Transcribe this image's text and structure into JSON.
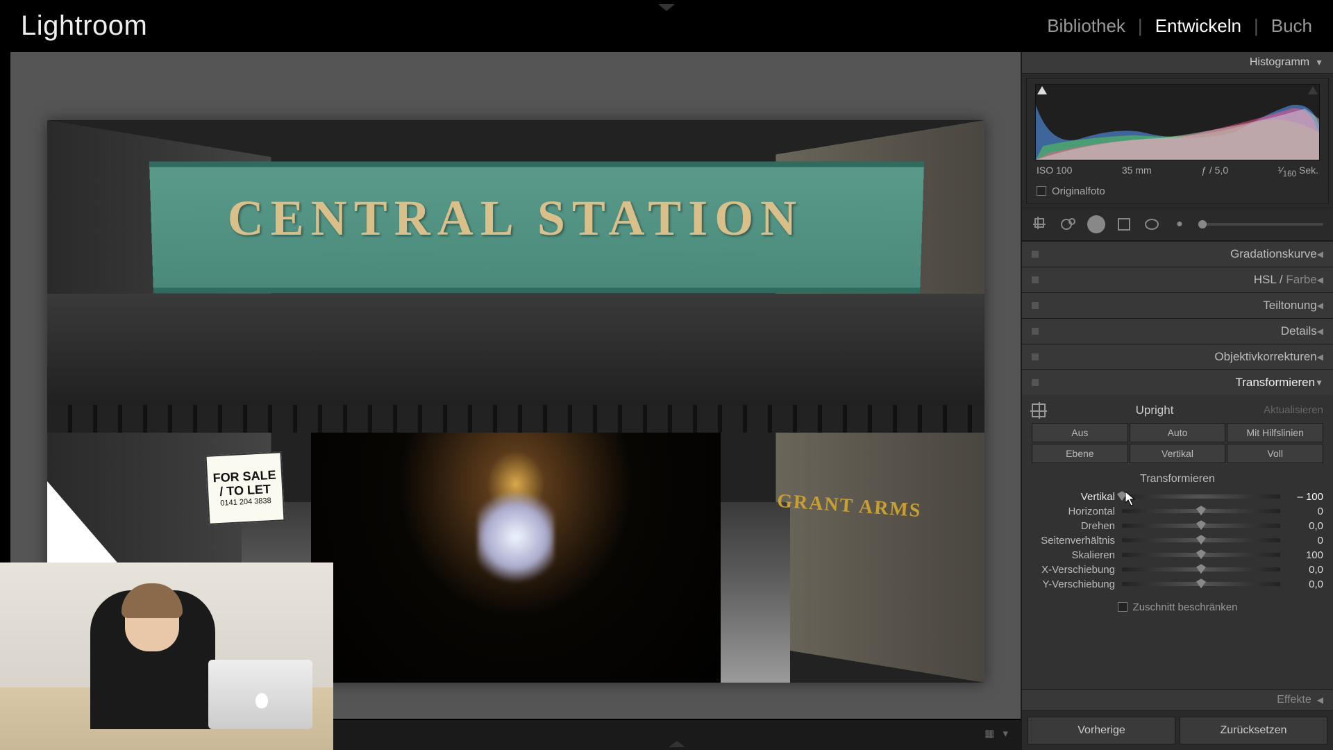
{
  "app": {
    "title": "Lightroom"
  },
  "modules": {
    "library": "Bibliothek",
    "develop": "Entwickeln",
    "book": "Buch"
  },
  "histogram": {
    "title": "Histogramm",
    "iso": "ISO 100",
    "focal": "35 mm",
    "aperture": "ƒ / 5,0",
    "shutter_pre": "¹⁄",
    "shutter_den": "160",
    "shutter_suf": " Sek.",
    "original": "Originalfoto"
  },
  "sections": {
    "tonecurve": "Gradationskurve",
    "hsl_a": "HSL",
    "hsl_b": "Farbe",
    "split": "Teiltonung",
    "detail": "Details",
    "lens": "Objektivkorrekturen",
    "transform": "Transformieren",
    "effects": "Effekte"
  },
  "upright": {
    "title": "Upright",
    "update": "Aktualisieren",
    "off": "Aus",
    "auto": "Auto",
    "guided": "Mit Hilfslinien",
    "level": "Ebene",
    "vertical": "Vertikal",
    "full": "Voll"
  },
  "transform": {
    "title": "Transformieren",
    "vertical": {
      "label": "Vertikal",
      "value": "– 100",
      "pos": 0
    },
    "horizontal": {
      "label": "Horizontal",
      "value": "0",
      "pos": 50
    },
    "rotate": {
      "label": "Drehen",
      "value": "0,0",
      "pos": 50
    },
    "aspect": {
      "label": "Seitenverhältnis",
      "value": "0",
      "pos": 50
    },
    "scale": {
      "label": "Skalieren",
      "value": "100",
      "pos": 50
    },
    "xoff": {
      "label": "X-Verschiebung",
      "value": "0,0",
      "pos": 50
    },
    "yoff": {
      "label": "Y-Verschiebung",
      "value": "0,0",
      "pos": 50
    },
    "constrain": "Zuschnitt beschränken"
  },
  "bottom": {
    "prev": "Vorherige",
    "reset": "Zurücksetzen"
  },
  "photo": {
    "sign": "CENTRAL STATION",
    "forsale_1": "FOR SALE",
    "forsale_2": "/ TO LET",
    "forsale_3": "0141 204 3838",
    "grant": "GRANT ARMS"
  }
}
